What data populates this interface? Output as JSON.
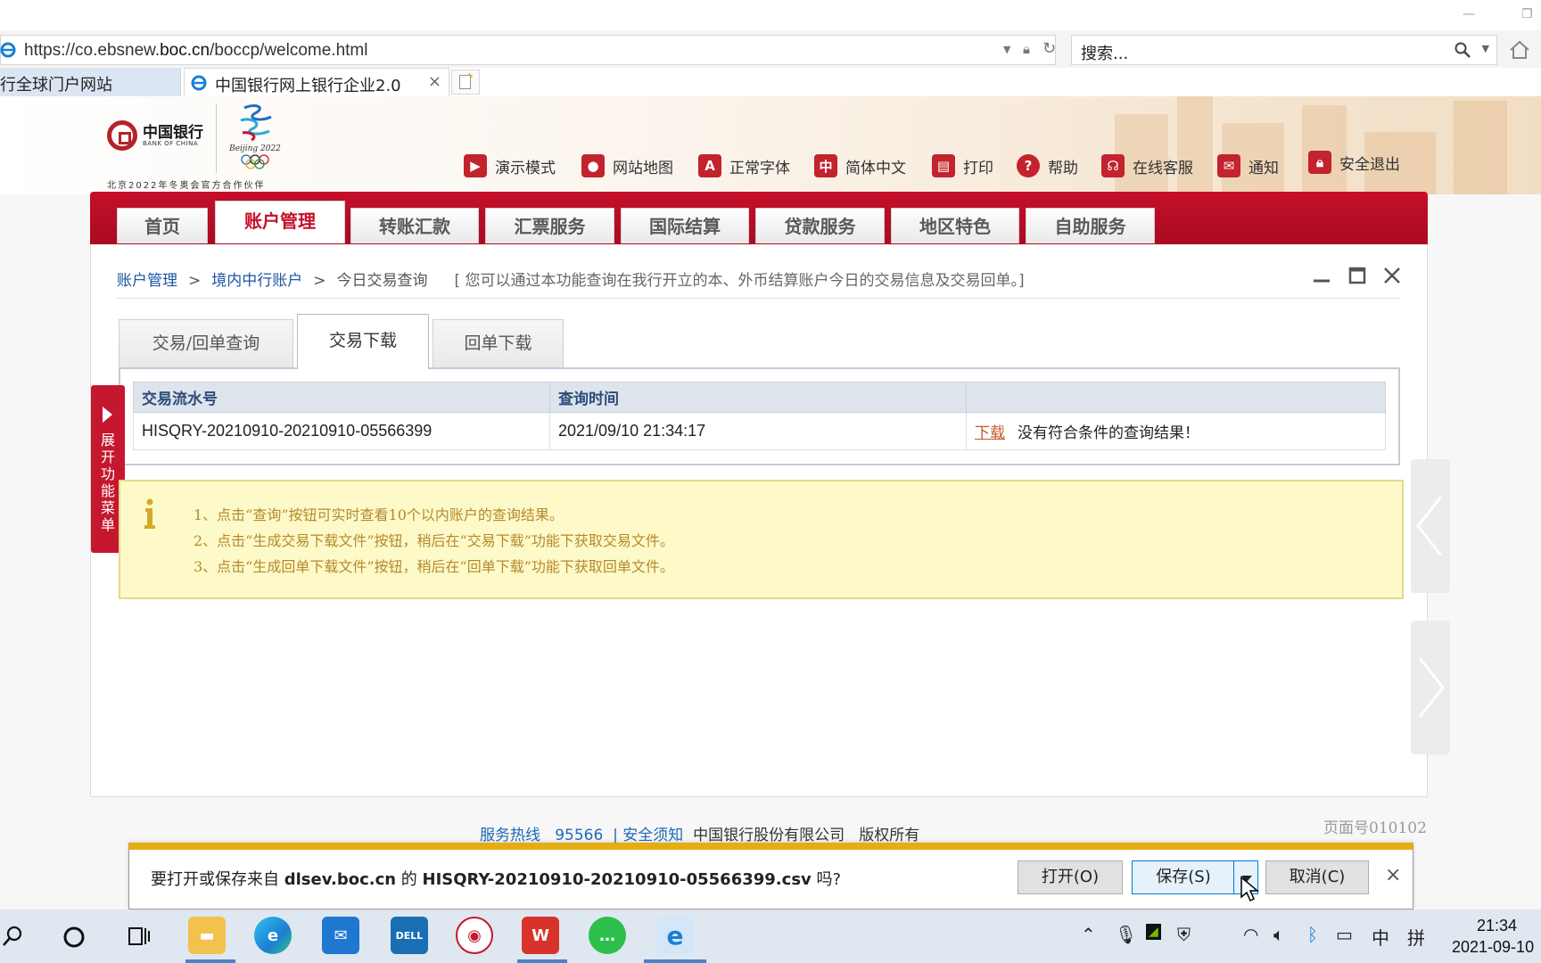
{
  "browser": {
    "url_prefix": "https://co.ebsnew.",
    "url_domain": "boc.cn",
    "url_path": "/boccp/welcome.html",
    "search_placeholder": "搜索...",
    "tabs": [
      {
        "label": "行全球门户网站"
      },
      {
        "label": "中国银行网上银行企业2.0"
      }
    ]
  },
  "header": {
    "bank_name_cn": "中国银行",
    "bank_name_en": "BANK OF CHINA",
    "olympic_text": "Beijing 2022",
    "partner_text": "北京2022年冬奥会官方合作伙伴",
    "links": [
      {
        "label": "演示模式",
        "icon": "play-icon"
      },
      {
        "label": "网站地图",
        "icon": "map-pin-icon"
      },
      {
        "label": "正常字体",
        "icon": "font-icon"
      },
      {
        "label": "简体中文",
        "icon": "language-icon"
      },
      {
        "label": "打印",
        "icon": "printer-icon"
      },
      {
        "label": "帮助",
        "icon": "help-icon"
      },
      {
        "label": "在线客服",
        "icon": "headset-icon"
      },
      {
        "label": "通知",
        "icon": "mail-icon"
      },
      {
        "label": "安全退出",
        "icon": "lock-icon"
      }
    ]
  },
  "nav": {
    "tabs": [
      {
        "label": "首页"
      },
      {
        "label": "账户管理",
        "active": true
      },
      {
        "label": "转账汇款"
      },
      {
        "label": "汇票服务"
      },
      {
        "label": "国际结算"
      },
      {
        "label": "贷款服务"
      },
      {
        "label": "地区特色"
      },
      {
        "label": "自助服务"
      }
    ]
  },
  "breadcrumb": {
    "items": [
      "账户管理",
      "境内中行账户",
      "今日交易查询"
    ],
    "separator": ">",
    "tip": "[ 您可以通过本功能查询在我行开立的本、外币结算账户今日的交易信息及交易回单。]"
  },
  "subtabs": [
    {
      "label": "交易/回单查询"
    },
    {
      "label": "交易下载",
      "active": true
    },
    {
      "label": "回单下载"
    }
  ],
  "table": {
    "headers": [
      "交易流水号",
      "查询时间",
      ""
    ],
    "rows": [
      {
        "serial": "HISQRY-20210910-20210910-05566399",
        "time": "2021/09/10 21:34:17",
        "link": "下载",
        "status": "没有符合条件的查询结果！"
      }
    ]
  },
  "side_menu": {
    "label": "展开功能菜单"
  },
  "info": {
    "lines": [
      "1、点击“查询”按钮可实时查看10个以内账户的查询结果。",
      "2、点击“生成交易下载文件”按钮，稍后在“交易下载”功能下获取交易文件。",
      "3、点击“生成回单下载文件”按钮，稍后在“回单下载”功能下获取回单文件。"
    ]
  },
  "footer": {
    "hotline_label": "服务热线",
    "hotline_number": "95566",
    "security_link": "| 安全须知",
    "company": "中国银行股份有限公司",
    "copyright": "版权所有",
    "page_number": "页面号010102"
  },
  "download_bar": {
    "prefix": "要打开或保存来自 ",
    "domain": "dlsev.boc.cn",
    "middle": " 的 ",
    "filename": "HISQRY-20210910-20210910-05566399.csv",
    "suffix": " 吗?",
    "open_label": "打开(O)",
    "save_label": "保存(S)",
    "cancel_label": "取消(C)",
    "close": "×"
  },
  "taskbar": {
    "time": "21:34",
    "date": "2021-09-10",
    "ime": "中",
    "ime2": "拼"
  },
  "colors": {
    "brand_red": "#c50f2a",
    "link_blue": "#1e55a5",
    "info_text": "#b58a2c",
    "dialog_accent": "#e6ad12"
  }
}
